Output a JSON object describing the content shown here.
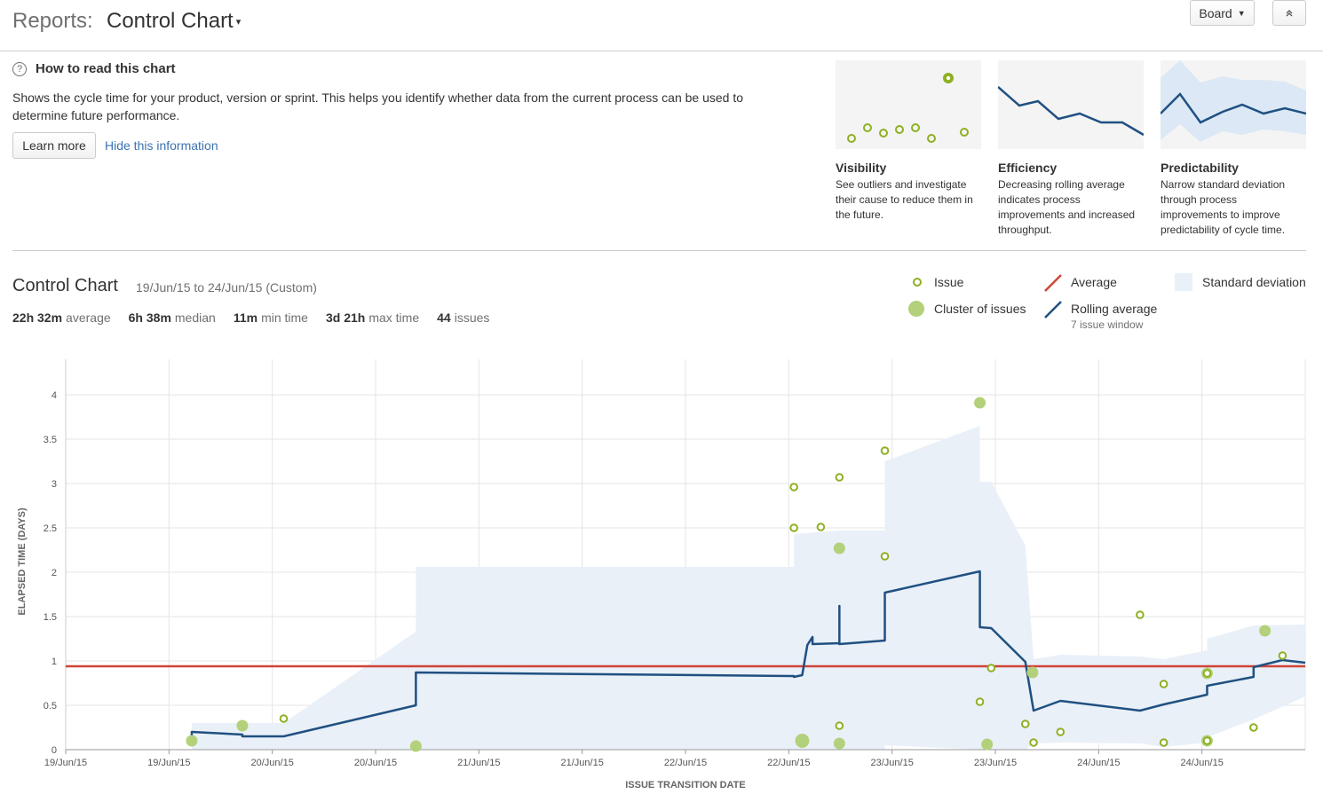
{
  "header": {
    "reports_label": "Reports:",
    "report_name": "Control Chart",
    "board_button": "Board",
    "collapse_icon": "chevron-up-icon"
  },
  "info": {
    "title": "How to read this chart",
    "description": "Shows the cycle time for your product, version or sprint. This helps you identify whether data from the current process can be used to determine future performance.",
    "learn_more": "Learn more",
    "hide_link": "Hide this information",
    "cards": [
      {
        "title": "Visibility",
        "text": "See outliers and investigate their cause to reduce them in the future."
      },
      {
        "title": "Efficiency",
        "text": "Decreasing rolling average indicates process improvements and increased throughput."
      },
      {
        "title": "Predictability",
        "text": "Narrow standard deviation through process improvements to improve predictability of cycle time."
      }
    ]
  },
  "control_chart": {
    "title": "Control Chart",
    "date_range": "19/Jun/15 to 24/Jun/15 (Custom)",
    "stats": [
      {
        "value": "22h 32m",
        "label": "average"
      },
      {
        "value": "6h 38m",
        "label": "median"
      },
      {
        "value": "11m",
        "label": "min time"
      },
      {
        "value": "3d 21h",
        "label": "max time"
      },
      {
        "value": "44",
        "label": "issues"
      }
    ]
  },
  "legend": {
    "issue": "Issue",
    "cluster": "Cluster of issues",
    "average": "Average",
    "rolling_average": "Rolling average",
    "rolling_window": "7 issue window",
    "std_dev": "Standard deviation"
  },
  "colors": {
    "issue": "#8eb021",
    "cluster": "#b3d17a",
    "average": "#d04437",
    "rolling": "#205081",
    "stddev": "#e9f0f8",
    "grid": "#e5e5e5",
    "link": "#3b73af"
  },
  "chart_data": {
    "type": "scatter",
    "xlabel": "ISSUE TRANSITION DATE",
    "ylabel": "ELAPSED TIME (DAYS)",
    "xlim": [
      0,
      12
    ],
    "ylim": [
      0,
      4.4
    ],
    "x_unit": "half-days from 19/Jun/15 00:00",
    "x_tick_labels": [
      "19/Jun/15",
      "19/Jun/15",
      "20/Jun/15",
      "20/Jun/15",
      "21/Jun/15",
      "21/Jun/15",
      "22/Jun/15",
      "22/Jun/15",
      "23/Jun/15",
      "23/Jun/15",
      "24/Jun/15",
      "24/Jun/15"
    ],
    "y_ticks": [
      0,
      0.5,
      1,
      1.5,
      2,
      2.5,
      3,
      3.5,
      4
    ],
    "y_tick_labels": [
      "0",
      "0.5",
      "1",
      "1.5",
      "2",
      "2.5",
      "3",
      "3.5",
      "4"
    ],
    "average": 0.94,
    "issues": [
      [
        2.11,
        0.35
      ],
      [
        7.05,
        2.96
      ],
      [
        7.05,
        2.5
      ],
      [
        7.31,
        2.51
      ],
      [
        7.49,
        3.07
      ],
      [
        7.49,
        0.27
      ],
      [
        7.93,
        3.37
      ],
      [
        7.93,
        2.18
      ],
      [
        8.85,
        0.54
      ],
      [
        8.96,
        0.92
      ],
      [
        9.29,
        0.29
      ],
      [
        9.37,
        0.08
      ],
      [
        9.63,
        0.2
      ],
      [
        10.4,
        1.52
      ],
      [
        10.63,
        0.74
      ],
      [
        10.63,
        0.08
      ],
      [
        11.05,
        0.86
      ],
      [
        11.05,
        0.1
      ],
      [
        11.5,
        0.25
      ],
      [
        11.78,
        1.06
      ]
    ],
    "clusters": [
      {
        "x": 1.22,
        "y": 0.1,
        "size": 1
      },
      {
        "x": 1.71,
        "y": 0.27,
        "size": 1
      },
      {
        "x": 3.39,
        "y": 0.04,
        "size": 1
      },
      {
        "x": 7.13,
        "y": 0.1,
        "size": 2
      },
      {
        "x": 7.49,
        "y": 2.27,
        "size": 1
      },
      {
        "x": 7.49,
        "y": 0.07,
        "size": 1
      },
      {
        "x": 8.85,
        "y": 3.91,
        "size": 1
      },
      {
        "x": 8.92,
        "y": 0.06,
        "size": 1
      },
      {
        "x": 9.36,
        "y": 0.87,
        "size": 1
      },
      {
        "x": 11.05,
        "y": 0.86,
        "size": 1
      },
      {
        "x": 11.05,
        "y": 0.1,
        "size": 1
      },
      {
        "x": 11.61,
        "y": 1.34,
        "size": 1
      }
    ],
    "rolling_average": [
      [
        1.22,
        0.12
      ],
      [
        1.22,
        0.2
      ],
      [
        1.71,
        0.17
      ],
      [
        1.71,
        0.15
      ],
      [
        2.11,
        0.15
      ],
      [
        3.39,
        0.5
      ],
      [
        3.39,
        0.87
      ],
      [
        7.05,
        0.83
      ],
      [
        7.05,
        0.82
      ],
      [
        7.13,
        0.84
      ],
      [
        7.18,
        1.18
      ],
      [
        7.23,
        1.27
      ],
      [
        7.23,
        1.19
      ],
      [
        7.49,
        1.2
      ],
      [
        7.49,
        1.62
      ],
      [
        7.49,
        1.19
      ],
      [
        7.93,
        1.23
      ],
      [
        7.93,
        1.77
      ],
      [
        8.85,
        2.01
      ],
      [
        8.85,
        1.38
      ],
      [
        8.96,
        1.37
      ],
      [
        9.29,
        0.99
      ],
      [
        9.37,
        0.44
      ],
      [
        9.63,
        0.55
      ],
      [
        10.4,
        0.44
      ],
      [
        10.63,
        0.51
      ],
      [
        11.05,
        0.62
      ],
      [
        11.05,
        0.72
      ],
      [
        11.5,
        0.82
      ],
      [
        11.5,
        0.93
      ],
      [
        11.78,
        1.01
      ],
      [
        12,
        0.98
      ]
    ],
    "std_band": [
      [
        1.22,
        0.0,
        0.3
      ],
      [
        2.11,
        0.0,
        0.3
      ],
      [
        3.39,
        0.0,
        1.33
      ],
      [
        3.39,
        0.0,
        2.06
      ],
      [
        7.05,
        0.0,
        2.06
      ],
      [
        7.05,
        0.0,
        2.43
      ],
      [
        7.49,
        0.0,
        2.47
      ],
      [
        7.93,
        0.0,
        2.47
      ],
      [
        7.93,
        0.05,
        3.25
      ],
      [
        8.85,
        0.0,
        3.65
      ],
      [
        8.85,
        0.0,
        3.02
      ],
      [
        8.96,
        0.0,
        3.02
      ],
      [
        9.29,
        0.0,
        2.3
      ],
      [
        9.37,
        0.07,
        1.02
      ],
      [
        9.63,
        0.08,
        1.07
      ],
      [
        10.4,
        0.07,
        1.05
      ],
      [
        10.63,
        0.03,
        1.02
      ],
      [
        11.05,
        0.08,
        1.12
      ],
      [
        11.05,
        0.14,
        1.25
      ],
      [
        11.5,
        0.34,
        1.4
      ],
      [
        12,
        0.6,
        1.41
      ]
    ]
  }
}
